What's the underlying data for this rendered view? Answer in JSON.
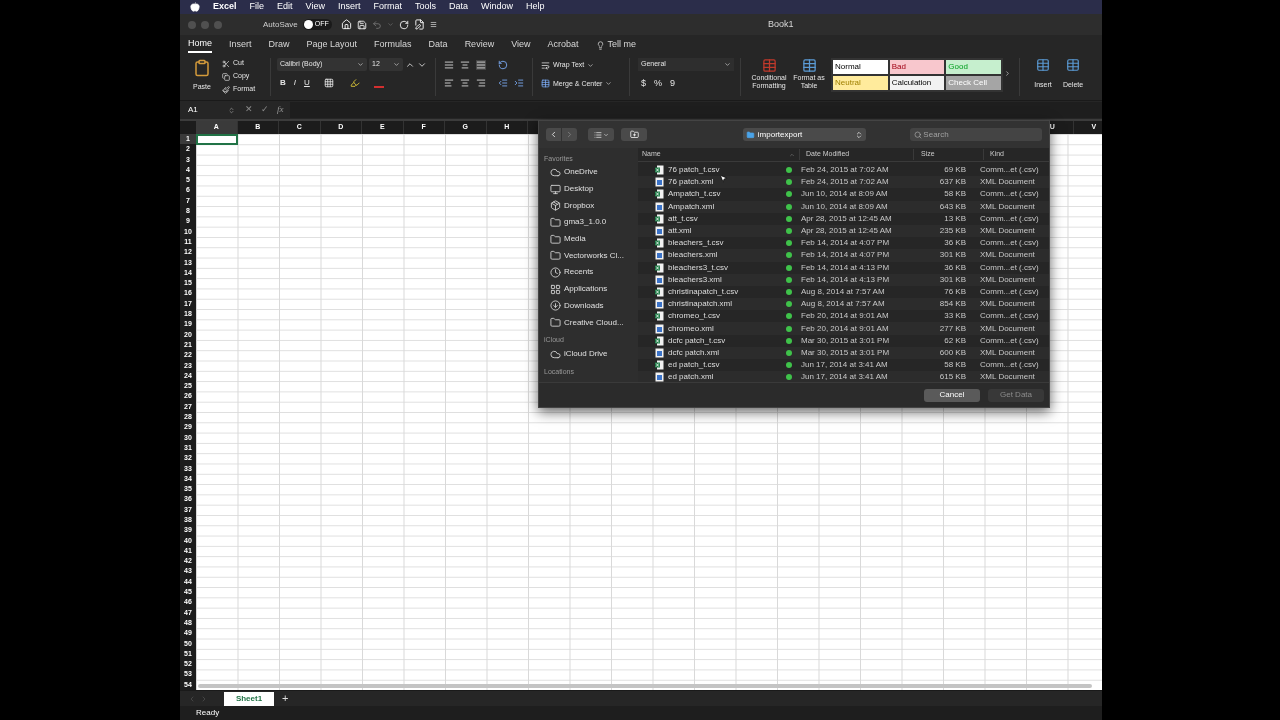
{
  "menu_bar": {
    "items": [
      {
        "label": "Excel",
        "bold": true
      },
      {
        "label": "File",
        "bold": false
      },
      {
        "label": "Edit",
        "bold": false
      },
      {
        "label": "View",
        "bold": false
      },
      {
        "label": "Insert",
        "bold": false
      },
      {
        "label": "Format",
        "bold": false
      },
      {
        "label": "Tools",
        "bold": false
      },
      {
        "label": "Data",
        "bold": false
      },
      {
        "label": "Window",
        "bold": false
      },
      {
        "label": "Help",
        "bold": false
      }
    ]
  },
  "title_bar": {
    "autosave_label": "AutoSave",
    "autosave": {
      "on": false,
      "label": "OFF"
    },
    "title": "Book1"
  },
  "ribbon_tabs": [
    {
      "label": "Home",
      "selected": true
    },
    {
      "label": "Insert",
      "selected": false
    },
    {
      "label": "Draw",
      "selected": false
    },
    {
      "label": "Page Layout",
      "selected": false
    },
    {
      "label": "Formulas",
      "selected": false
    },
    {
      "label": "Data",
      "selected": false
    },
    {
      "label": "Review",
      "selected": false
    },
    {
      "label": "View",
      "selected": false
    },
    {
      "label": "Acrobat",
      "selected": false
    },
    {
      "label": "Tell me",
      "selected": false,
      "kind": "search"
    }
  ],
  "ribbon": {
    "paste": "Paste",
    "clipboard": [
      "Cut",
      "Copy",
      "Format"
    ],
    "font_name": "Calibri (Body)",
    "font_size": "12",
    "font_styles": [
      "B",
      "I",
      "U"
    ],
    "wrap_text": "Wrap Text",
    "merge": "Merge & Center",
    "number_format": "General",
    "number_buttons": [
      "$",
      "%",
      "9"
    ],
    "conditional": "Conditional Formatting",
    "format_table": "Format as Table",
    "styles": [
      {
        "label": "Normal",
        "color": "#ffffff"
      },
      {
        "label": "Bad",
        "color": "#f8c7cd"
      },
      {
        "label": "Good",
        "color": "#c6efce"
      },
      {
        "label": "Neutral",
        "color": "#ffeb9c"
      },
      {
        "label": "Calculation",
        "color": "#f2f2f2"
      },
      {
        "label": "Check Cell",
        "color": "#a5a5a5"
      }
    ],
    "cells": [
      "Insert",
      "Delete"
    ]
  },
  "formula_bar": {
    "name_box": "A1",
    "cancel": "✕",
    "enter": "✓",
    "fx": "fx"
  },
  "column_headers": {
    "left": [
      "A",
      "B",
      "C",
      "D",
      "E",
      "F",
      "G",
      "H"
    ],
    "right": [
      "U",
      "V"
    ]
  },
  "row_numbers": [
    "1",
    "2",
    "3",
    "4",
    "5",
    "6",
    "7",
    "8",
    "9",
    "10",
    "11",
    "12",
    "13",
    "14",
    "15",
    "16",
    "17",
    "18",
    "19",
    "20",
    "21",
    "22",
    "23",
    "24",
    "25",
    "26",
    "27",
    "28",
    "29",
    "30",
    "31",
    "32",
    "33",
    "34",
    "35",
    "36",
    "37",
    "38",
    "39",
    "40",
    "41",
    "42",
    "43",
    "44",
    "45",
    "46",
    "47",
    "48",
    "49",
    "50",
    "51",
    "52",
    "53",
    "54"
  ],
  "sheet_tabs": {
    "tabs": [
      {
        "label": "Sheet1",
        "selected": true
      }
    ],
    "add": "+"
  },
  "status_bar": "Ready",
  "dialog": {
    "location": "importexport",
    "search": {
      "placeholder": "Search"
    },
    "sidebar": [
      {
        "heading": "Favorites",
        "items": [
          {
            "label": "OneDrive",
            "kind": "cloud"
          },
          {
            "label": "Desktop",
            "kind": "display"
          },
          {
            "label": "Dropbox",
            "kind": "box"
          },
          {
            "label": "gma3_1.0.0",
            "kind": "folder"
          },
          {
            "label": "Media",
            "kind": "folder"
          },
          {
            "label": "Vectorworks Cl...",
            "kind": "folder"
          },
          {
            "label": "Recents",
            "kind": "recent"
          },
          {
            "label": "Applications",
            "kind": "apps"
          },
          {
            "label": "Downloads",
            "kind": "download"
          },
          {
            "label": "Creative Cloud...",
            "kind": "folder"
          }
        ]
      },
      {
        "heading": "iCloud",
        "items": [
          {
            "label": "iCloud Drive",
            "kind": "cloud"
          }
        ]
      },
      {
        "heading": "Locations"
      }
    ],
    "columns": [
      "Name",
      "Date Modified",
      "Size",
      "Kind"
    ],
    "files": [
      {
        "name": "76 patch_t.csv",
        "kind": "csv",
        "date": "Feb 24, 2015 at 7:02 AM",
        "size": "69 KB",
        "type": "Comm...et (.csv)"
      },
      {
        "name": "76 patch.xml",
        "kind": "xml",
        "date": "Feb 24, 2015 at 7:02 AM",
        "size": "637 KB",
        "type": "XML Document"
      },
      {
        "name": "Ampatch_t.csv",
        "kind": "csv",
        "date": "Jun 10, 2014 at 8:09 AM",
        "size": "58 KB",
        "type": "Comm...et (.csv)"
      },
      {
        "name": "Ampatch.xml",
        "kind": "xml",
        "date": "Jun 10, 2014 at 8:09 AM",
        "size": "643 KB",
        "type": "XML Document"
      },
      {
        "name": "att_t.csv",
        "kind": "csv",
        "date": "Apr 28, 2015 at 12:45 AM",
        "size": "13 KB",
        "type": "Comm...et (.csv)"
      },
      {
        "name": "att.xml",
        "kind": "xml",
        "date": "Apr 28, 2015 at 12:45 AM",
        "size": "235 KB",
        "type": "XML Document"
      },
      {
        "name": "bleachers_t.csv",
        "kind": "csv",
        "date": "Feb 14, 2014 at 4:07 PM",
        "size": "36 KB",
        "type": "Comm...et (.csv)"
      },
      {
        "name": "bleachers.xml",
        "kind": "xml",
        "date": "Feb 14, 2014 at 4:07 PM",
        "size": "301 KB",
        "type": "XML Document"
      },
      {
        "name": "bleachers3_t.csv",
        "kind": "csv",
        "date": "Feb 14, 2014 at 4:13 PM",
        "size": "36 KB",
        "type": "Comm...et (.csv)"
      },
      {
        "name": "bleachers3.xml",
        "kind": "xml",
        "date": "Feb 14, 2014 at 4:13 PM",
        "size": "301 KB",
        "type": "XML Document"
      },
      {
        "name": "christinapatch_t.csv",
        "kind": "csv",
        "date": "Aug 8, 2014 at 7:57 AM",
        "size": "76 KB",
        "type": "Comm...et (.csv)"
      },
      {
        "name": "christinapatch.xml",
        "kind": "xml",
        "date": "Aug 8, 2014 at 7:57 AM",
        "size": "854 KB",
        "type": "XML Document"
      },
      {
        "name": "chromeo_t.csv",
        "kind": "csv",
        "date": "Feb 20, 2014 at 9:01 AM",
        "size": "33 KB",
        "type": "Comm...et (.csv)"
      },
      {
        "name": "chromeo.xml",
        "kind": "xml",
        "date": "Feb 20, 2014 at 9:01 AM",
        "size": "277 KB",
        "type": "XML Document"
      },
      {
        "name": "dcfc patch_t.csv",
        "kind": "csv",
        "date": "Mar 30, 2015 at 3:01 PM",
        "size": "62 KB",
        "type": "Comm...et (.csv)"
      },
      {
        "name": "dcfc patch.xml",
        "kind": "xml",
        "date": "Mar 30, 2015 at 3:01 PM",
        "size": "600 KB",
        "type": "XML Document"
      },
      {
        "name": "ed patch_t.csv",
        "kind": "csv",
        "date": "Jun 17, 2014 at 3:41 AM",
        "size": "58 KB",
        "type": "Comm...et (.csv)"
      },
      {
        "name": "ed patch.xml",
        "kind": "xml",
        "date": "Jun 17, 2014 at 3:41 AM",
        "size": "615 KB",
        "type": "XML Document"
      }
    ],
    "buttons": [
      {
        "label": "Cancel",
        "disabled": false
      },
      {
        "label": "Get Data",
        "disabled": true
      }
    ]
  }
}
